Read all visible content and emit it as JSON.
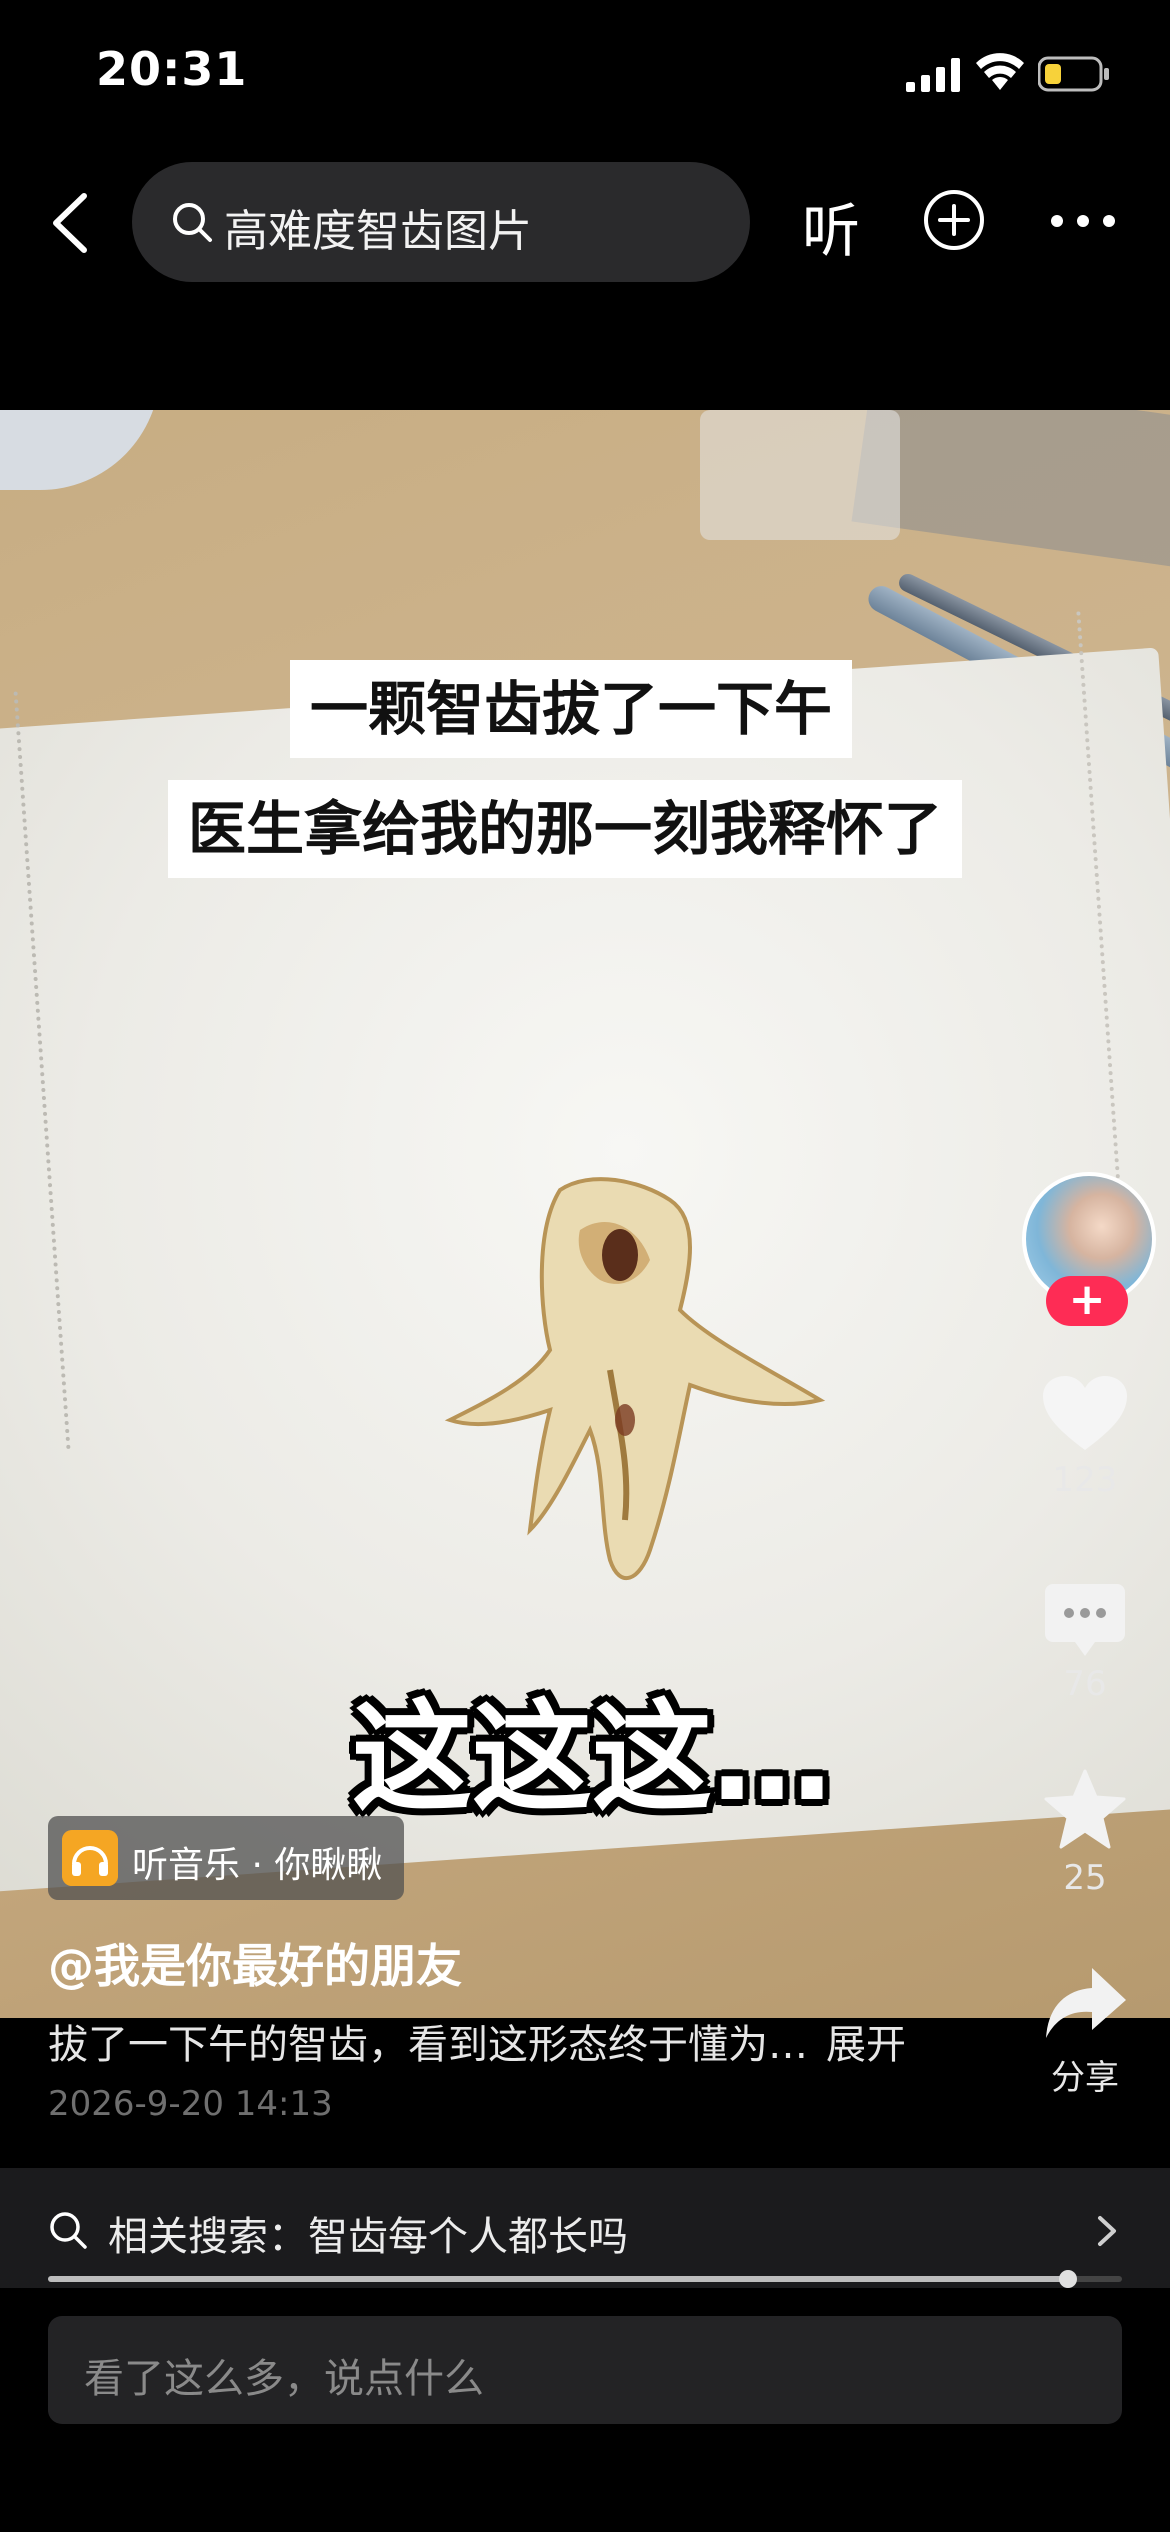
{
  "status_bar": {
    "time": "20:31"
  },
  "header": {
    "search_text": "高难度智齿图片",
    "listen_label": "听",
    "icons": {
      "back": "chevron-left-icon",
      "search": "search-icon",
      "add": "plus-circle-icon",
      "more": "more-horizontal-icon"
    }
  },
  "video": {
    "caption_line1": "一颗智齿拔了一下午",
    "caption_line2": "医生拿给我的那一刻我释怀了",
    "big_caption": "这这这…"
  },
  "music": {
    "label": "听音乐 · 你瞅瞅",
    "icon": "headphones-icon"
  },
  "post": {
    "author": "@我是你最好的朋友",
    "description": "拔了一下午的智齿，看到这形态终于懂为…",
    "expand_label": "展开",
    "date": "2026-9-20 14:13"
  },
  "right_rail": {
    "follow_label": "+",
    "likes": "123",
    "comments": "76",
    "favorites": "25",
    "share_label": "分享"
  },
  "related_search": {
    "label": "相关搜索：智齿每个人都长吗"
  },
  "progress": {
    "fraction": 0.95
  },
  "comment_input": {
    "placeholder": "看了这么多，说点什么"
  },
  "colors": {
    "follow_red": "#fe2c55",
    "music_orange": "#f5a623"
  }
}
